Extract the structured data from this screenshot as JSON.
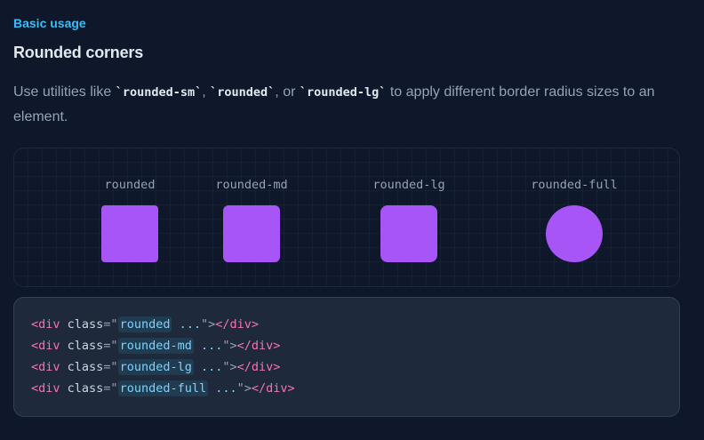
{
  "section": {
    "eyebrow": "Basic usage",
    "title": "Rounded corners",
    "description": {
      "pre": "Use utilities like ",
      "code1": "`rounded-sm`",
      "sep1": ", ",
      "code2": "`rounded`",
      "sep2": ", or ",
      "code3": "`rounded-lg`",
      "post": " to apply different border radius sizes to an element."
    }
  },
  "preview": {
    "swatch_color": "#a855f7",
    "samples": [
      {
        "label": "rounded"
      },
      {
        "label": "rounded-md"
      },
      {
        "label": "rounded-lg"
      },
      {
        "label": "rounded-full"
      }
    ]
  },
  "code": {
    "lines": [
      {
        "open": "<div",
        "attr": " class",
        "eq": "=\"",
        "value": "rounded",
        "ellipsis": " ...",
        "close_quote": "\">",
        "close": "</div>"
      },
      {
        "open": "<div",
        "attr": " class",
        "eq": "=\"",
        "value": "rounded-md",
        "ellipsis": " ...",
        "close_quote": "\">",
        "close": "</div>"
      },
      {
        "open": "<div",
        "attr": " class",
        "eq": "=\"",
        "value": "rounded-lg",
        "ellipsis": " ...",
        "close_quote": "\">",
        "close": "</div>"
      },
      {
        "open": "<div",
        "attr": " class",
        "eq": "=\"",
        "value": "rounded-full",
        "ellipsis": " ...",
        "close_quote": "\">",
        "close": "</div>"
      }
    ]
  }
}
